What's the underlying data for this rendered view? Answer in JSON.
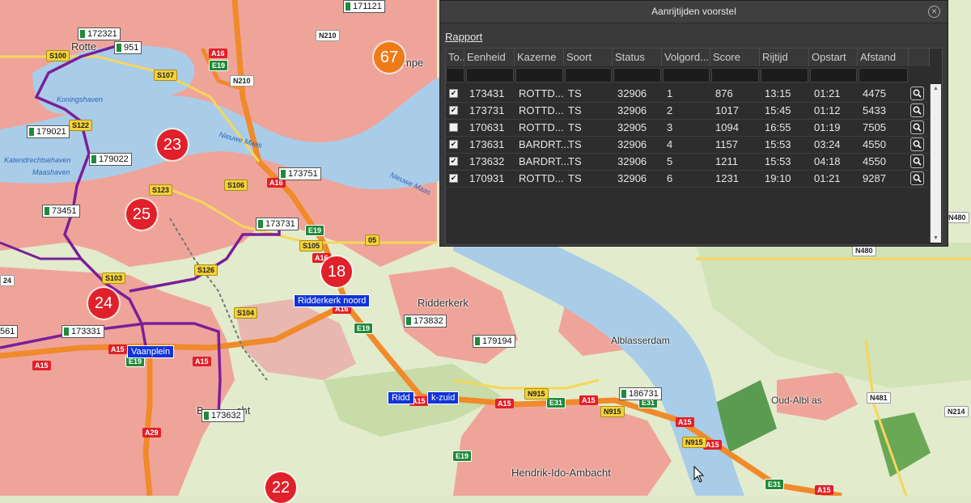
{
  "dialog": {
    "title": "Aanrijtijden voorstel",
    "report_link": "Rapport",
    "columns": [
      "To...",
      "Eenheid",
      "Kazerne",
      "Soort",
      "Status",
      "Volgord...",
      "Score",
      "Rijtijd",
      "Opstart",
      "Afstand"
    ],
    "rows": [
      {
        "checked": true,
        "eenheid": "173431",
        "kazerne": "ROTTD...",
        "soort": "TS",
        "status": "32906",
        "volgorde": "1",
        "score": "876",
        "rijtijd": "13:15",
        "opstart": "01:21",
        "afstand": "4475"
      },
      {
        "checked": true,
        "eenheid": "173731",
        "kazerne": "ROTTD...",
        "soort": "TS",
        "status": "32906",
        "volgorde": "2",
        "score": "1017",
        "rijtijd": "15:45",
        "opstart": "01:12",
        "afstand": "5433"
      },
      {
        "checked": false,
        "eenheid": "170631",
        "kazerne": "ROTTD...",
        "soort": "TS",
        "status": "32905",
        "volgorde": "3",
        "score": "1094",
        "rijtijd": "16:55",
        "opstart": "01:19",
        "afstand": "7505"
      },
      {
        "checked": true,
        "eenheid": "173631",
        "kazerne": "BARDRT...",
        "soort": "TS",
        "status": "32906",
        "volgorde": "4",
        "score": "1157",
        "rijtijd": "15:53",
        "opstart": "03:24",
        "afstand": "4550"
      },
      {
        "checked": true,
        "eenheid": "173632",
        "kazerne": "BARDRT...",
        "soort": "TS",
        "status": "32906",
        "volgorde": "5",
        "score": "1211",
        "rijtijd": "15:53",
        "opstart": "04:18",
        "afstand": "4550"
      },
      {
        "checked": true,
        "eenheid": "170931",
        "kazerne": "ROTTD...",
        "soort": "TS",
        "status": "32906",
        "volgorde": "6",
        "score": "1231",
        "rijtijd": "19:10",
        "opstart": "01:21",
        "afstand": "9287"
      }
    ]
  },
  "map": {
    "clusters": [
      {
        "count": "67",
        "color": "#f07a18"
      },
      {
        "count": "23",
        "color": "#e0202a"
      },
      {
        "count": "25",
        "color": "#e0202a"
      },
      {
        "count": "18",
        "color": "#e0202a"
      },
      {
        "count": "24",
        "color": "#e0202a"
      },
      {
        "count": "22",
        "color": "#e0202a"
      }
    ],
    "unit_tags": [
      "171121",
      "172321",
      "951",
      "179021",
      "179022",
      "173751",
      "73451",
      "173731",
      "173832",
      "179194",
      "173331",
      "173632",
      "186731",
      "561"
    ],
    "places": [
      "Rotte",
      "mpe",
      "Ridderkerk",
      "Alblasserdam",
      "Oud-Albl as",
      "Hendrik-Ido-Ambacht",
      "B",
      "cht"
    ],
    "blue_tags": [
      "Ridderkerk noord",
      "Vaanplein",
      "Ridd",
      "k-zuid"
    ],
    "road_shields": {
      "red": [
        "A16",
        "A16",
        "A16",
        "A16",
        "A15",
        "A15",
        "A15",
        "A15",
        "A15",
        "A15",
        "A15",
        "A29",
        "A15",
        "A15"
      ],
      "green": [
        "E19",
        "E19",
        "E19",
        "E19",
        "E31",
        "E31",
        "E19",
        "E31"
      ],
      "yellow": [
        "S100",
        "S107",
        "S122",
        "S123",
        "S106",
        "S105",
        "S104",
        "S126",
        "S103",
        "05",
        "N915",
        "N915",
        "N915"
      ],
      "white": [
        "N210",
        "N210",
        "N480",
        "N480",
        "N481",
        "N214",
        "24"
      ]
    },
    "water_labels": [
      "Nieuwe Maas",
      "Nieuwe Maas",
      "Maashaven",
      "Koningshaven",
      "Katendrechtsehaven"
    ]
  }
}
